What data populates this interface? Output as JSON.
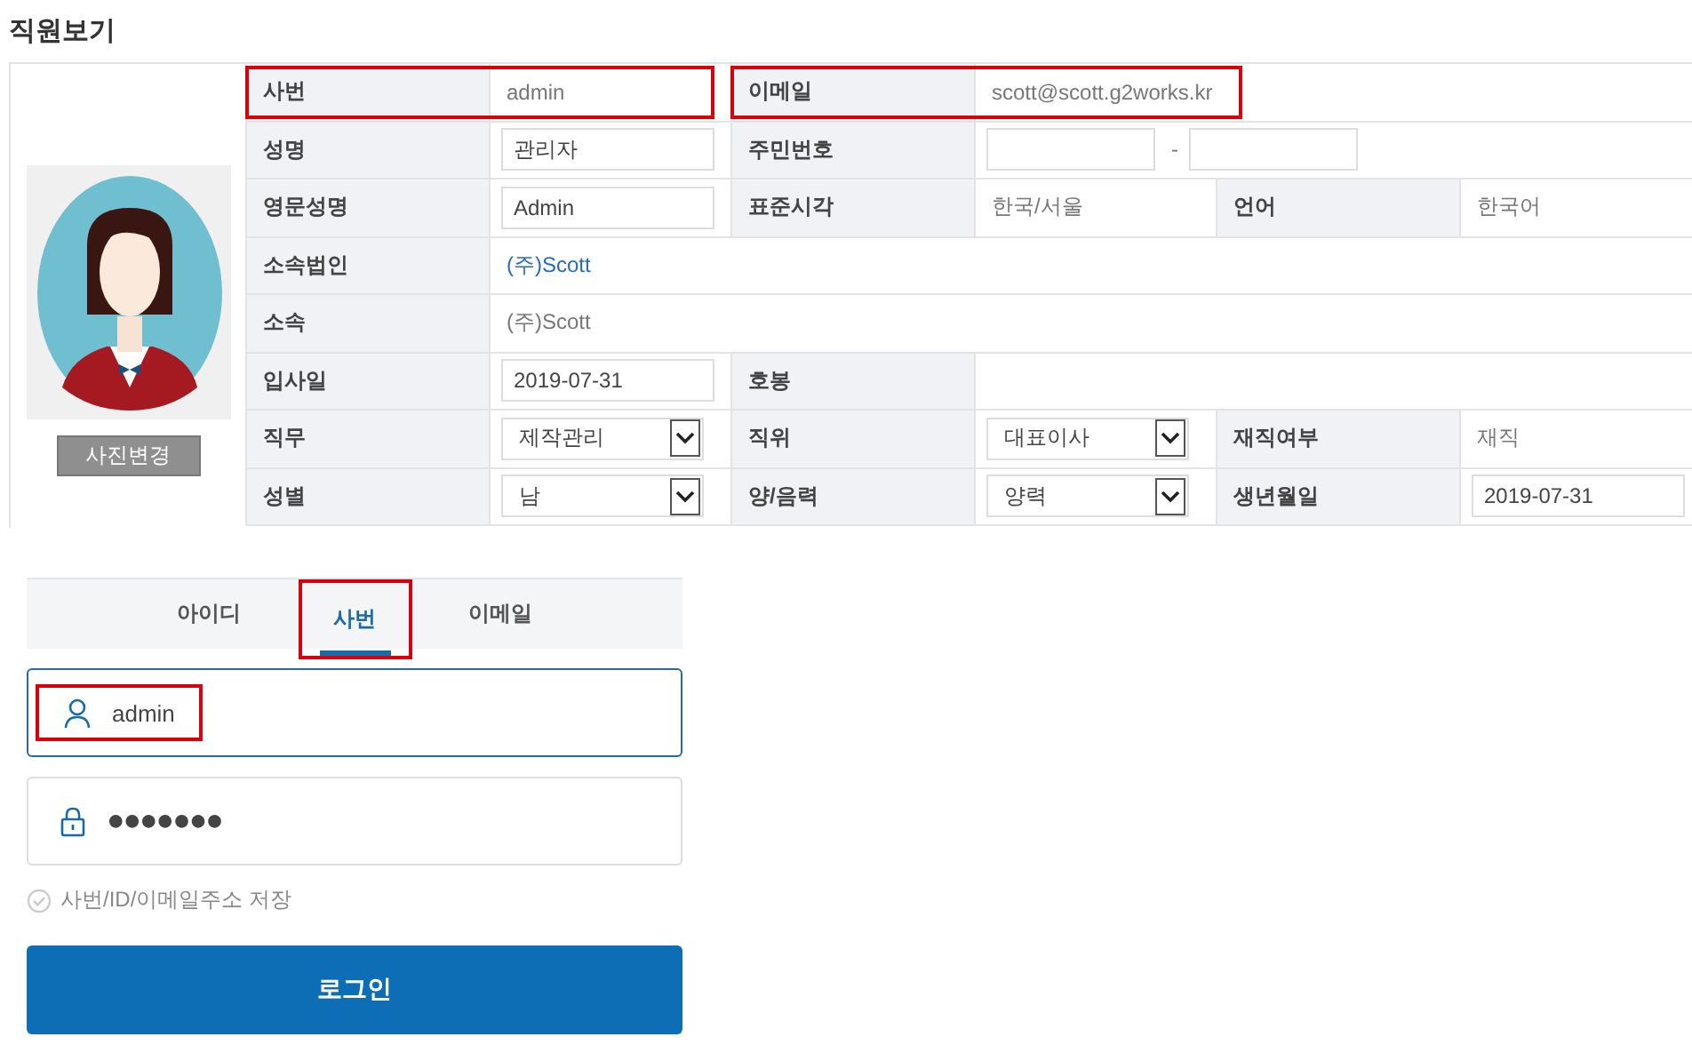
{
  "title": "직원보기",
  "profile": {
    "button": "사진변경"
  },
  "rows": [
    {
      "fields": [
        {
          "label": "사번",
          "kind": "text",
          "value": "admin",
          "highlighted": true
        },
        {
          "label": "이메일",
          "kind": "text",
          "value": "scott@scott.g2works.kr",
          "highlighted": true
        }
      ]
    },
    {
      "fields": [
        {
          "label": "성명",
          "kind": "input",
          "value": "관리자",
          "highlighted": false
        },
        {
          "label": "주민번호",
          "kind": "ssn",
          "separator": "-",
          "highlighted": false
        }
      ]
    },
    {
      "fields": [
        {
          "label": "영문성명",
          "kind": "input",
          "value": "Admin",
          "highlighted": false
        },
        {
          "label": "표준시각",
          "kind": "text",
          "value": "한국/서울",
          "highlighted": false
        },
        {
          "label": "언어",
          "kind": "text",
          "value": "한국어",
          "highlighted": false
        }
      ]
    },
    {
      "fields": [
        {
          "label": "소속법인",
          "kind": "link",
          "value": "(주)Scott",
          "highlighted": false
        }
      ]
    },
    {
      "fields": [
        {
          "label": "소속",
          "kind": "text",
          "value": "(주)Scott",
          "highlighted": false
        }
      ]
    },
    {
      "fields": [
        {
          "label": "입사일",
          "kind": "input",
          "value": "2019-07-31",
          "highlighted": false
        },
        {
          "label": "호봉",
          "kind": "text",
          "highlighted": false
        }
      ]
    },
    {
      "fields": [
        {
          "label": "직무",
          "kind": "select",
          "value": "제작관리",
          "highlighted": false
        },
        {
          "label": "직위",
          "kind": "select",
          "value": "대표이사",
          "highlighted": false
        },
        {
          "label": "재직여부",
          "kind": "text",
          "value": "재직",
          "highlighted": false
        }
      ]
    },
    {
      "fields": [
        {
          "label": "성별",
          "kind": "select",
          "value": "남",
          "highlighted": false
        },
        {
          "label": "양/음력",
          "kind": "select",
          "value": "양력",
          "highlighted": false
        },
        {
          "label": "생년월일",
          "kind": "input",
          "value": "2019-07-31",
          "highlighted": false
        }
      ]
    }
  ],
  "login": {
    "tabs": [
      {
        "label": "아이디",
        "selected": false,
        "highlighted": false
      },
      {
        "label": "사번",
        "selected": true,
        "highlighted": true
      },
      {
        "label": "이메일",
        "selected": false,
        "highlighted": false
      }
    ],
    "id_field": {
      "value": "admin",
      "focused": true,
      "highlighted": true
    },
    "password_field": {
      "value": "●●●●●●●",
      "focused": false
    },
    "remember": {
      "label": "사번/ID/이메일주소 저장",
      "checked": false
    },
    "button": "로그인"
  }
}
